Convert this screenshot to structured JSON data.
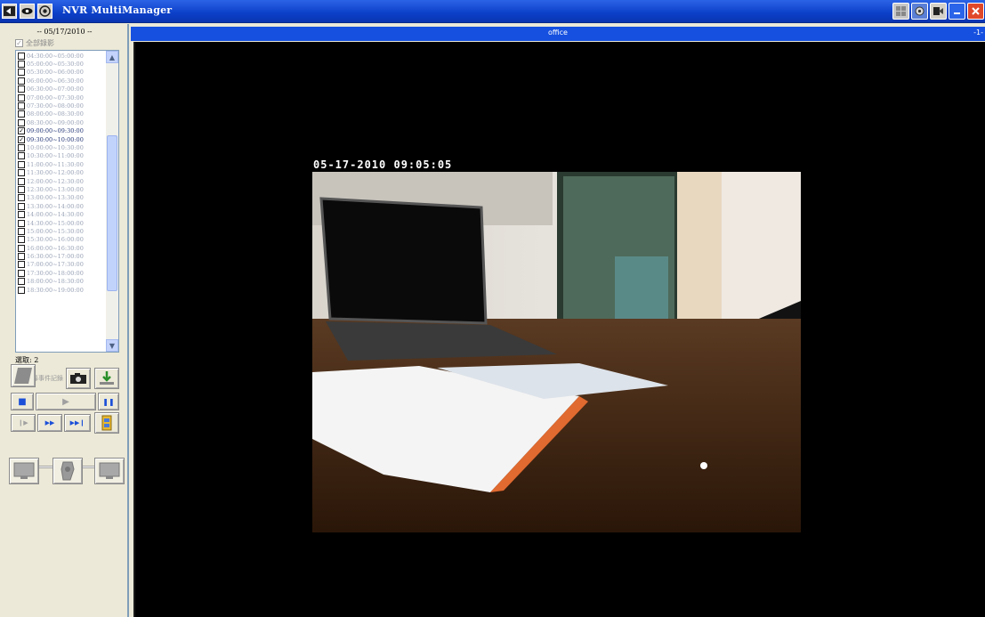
{
  "window": {
    "title": "NVR MultiManager",
    "icons": [
      "back-icon",
      "eye-icon",
      "camera-ring-icon"
    ],
    "controls": [
      "layout-icon",
      "settings-icon",
      "exit-icon",
      "minimize-icon",
      "close-icon"
    ]
  },
  "sidebar": {
    "date": "-- 05/17/2010 --",
    "all_label": "全部錄影",
    "time_slots": [
      {
        "label": "04:30:00~05:00:00",
        "checked": false
      },
      {
        "label": "05:00:00~05:30:00",
        "checked": false
      },
      {
        "label": "05:30:00~06:00:00",
        "checked": false
      },
      {
        "label": "06:00:00~06:30:00",
        "checked": false
      },
      {
        "label": "06:30:00~07:00:00",
        "checked": false
      },
      {
        "label": "07:00:00~07:30:00",
        "checked": false
      },
      {
        "label": "07:30:00~08:00:00",
        "checked": false
      },
      {
        "label": "08:00:00~08:30:00",
        "checked": false
      },
      {
        "label": "08:30:00~09:00:00",
        "checked": false
      },
      {
        "label": "09:00:00~09:30:00",
        "checked": true
      },
      {
        "label": "09:30:00~10:00:00",
        "checked": true
      },
      {
        "label": "10:00:00~10:30:00",
        "checked": false
      },
      {
        "label": "10:30:00~11:00:00",
        "checked": false
      },
      {
        "label": "11:00:00~11:30:00",
        "checked": false
      },
      {
        "label": "11:30:00~12:00:00",
        "checked": false
      },
      {
        "label": "12:00:00~12:30:00",
        "checked": false
      },
      {
        "label": "12:30:00~13:00:00",
        "checked": false
      },
      {
        "label": "13:00:00~13:30:00",
        "checked": false
      },
      {
        "label": "13:30:00~14:00:00",
        "checked": false
      },
      {
        "label": "14:00:00~14:30:00",
        "checked": false
      },
      {
        "label": "14:30:00~15:00:00",
        "checked": false
      },
      {
        "label": "15:00:00~15:30:00",
        "checked": false
      },
      {
        "label": "15:30:00~16:00:00",
        "checked": false
      },
      {
        "label": "16:00:00~16:30:00",
        "checked": false
      },
      {
        "label": "16:30:00~17:00:00",
        "checked": false
      },
      {
        "label": "17:00:00~17:30:00",
        "checked": false
      },
      {
        "label": "17:30:00~18:00:00",
        "checked": false
      },
      {
        "label": "18:00:00~18:30:00",
        "checked": false
      },
      {
        "label": "18:30:00~19:00:00",
        "checked": false
      }
    ],
    "selected_count": "選取: 2",
    "record_label": "搜尋事件記錄"
  },
  "playback": {
    "stop_glyph": "■",
    "play_glyph": "▶",
    "pause_glyph": "❚❚",
    "step_glyph": "❙▶",
    "fast_forward_glyph": "▶▶",
    "next_glyph": "▶▶❙"
  },
  "main": {
    "channel_title": "office",
    "corner_text": "-1-",
    "video_timestamp": "05-17-2010  09:05:05"
  }
}
